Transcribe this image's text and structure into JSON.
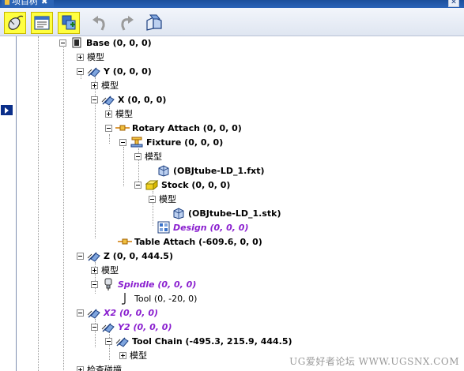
{
  "window": {
    "tab_title": "项目树",
    "pin_glyph": "✖",
    "close_glyph": "✕"
  },
  "toolbar": {
    "buttons": [
      {
        "name": "select-mouse-icon"
      },
      {
        "name": "properties-icon"
      },
      {
        "name": "add-component-icon"
      },
      {
        "name": "undo-icon"
      },
      {
        "name": "redo-icon"
      },
      {
        "name": "view-icon"
      }
    ]
  },
  "tree": {
    "nodes": {
      "base": "Base (0, 0, 0)",
      "base_model": "模型",
      "y": "Y (0, 0, 0)",
      "y_model": "模型",
      "x": "X (0, 0, 0)",
      "x_model": "模型",
      "rotary_attach": "Rotary Attach (0, 0, 0)",
      "fixture": "Fixture (0, 0, 0)",
      "fixture_model": "模型",
      "fixture_file": "(OBJtube-LD_1.fxt)",
      "stock": "Stock (0, 0, 0)",
      "stock_model": "模型",
      "stock_file": "(OBJtube-LD_1.stk)",
      "design": "Design (0, 0, 0)",
      "table_attach": "Table Attach (-609.6, 0, 0)",
      "z": "Z (0, 0, 444.5)",
      "z_model": "模型",
      "spindle": "Spindle (0, 0, 0)",
      "tool": "Tool (0, -20, 0)",
      "x2": "X2 (0, 0, 0)",
      "y2": "Y2 (0, 0, 0)",
      "tool_chain": "Tool Chain (-495.3, 215.9, 444.5)",
      "tool_chain_model": "模型",
      "bottom_cut": "检查碰撞"
    }
  },
  "watermark": "UG爱好者论坛 WWW.UGSNX.COM",
  "colors": {
    "accent": "#0b2f8a",
    "highlight": "#ffff40",
    "purple": "#8a1fcf",
    "titlebar": "#2a63b8"
  }
}
